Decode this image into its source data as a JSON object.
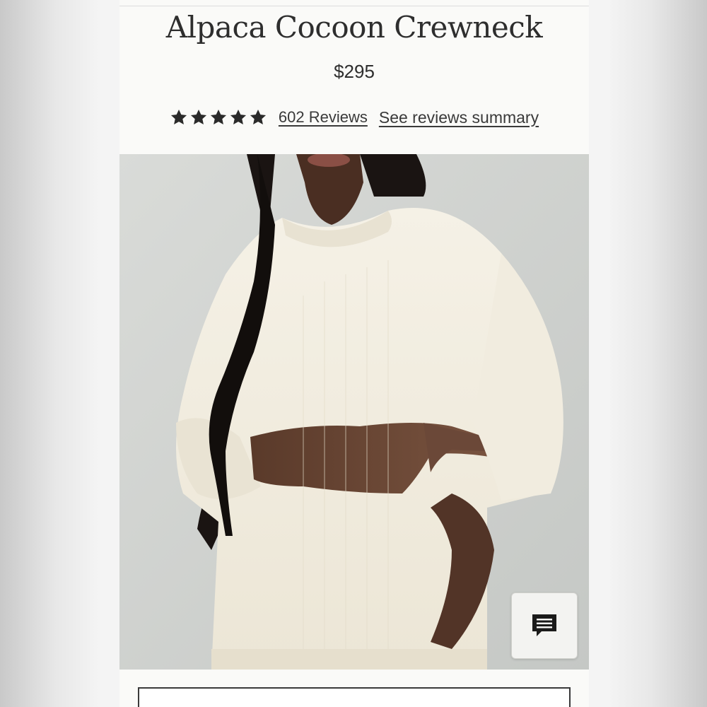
{
  "product": {
    "title": "Alpaca Cocoon Crewneck",
    "price": "$295",
    "rating": 5,
    "rating_max": 5,
    "reviews_link": "602 Reviews",
    "summary_link": "See reviews summary"
  },
  "image": {
    "subject": "model wearing cream oversized knit sweater"
  },
  "chat": {
    "icon": "chat-icon"
  },
  "colors": {
    "text": "#2e2e2e",
    "background": "#fafaf8",
    "sweater": "#f2ede0",
    "chat_button": "#f3f3f1"
  }
}
